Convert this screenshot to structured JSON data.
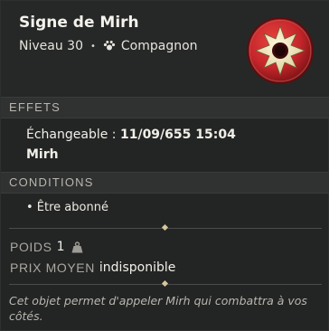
{
  "item": {
    "name": "Signe de Mirh",
    "level_label": "Niveau 30",
    "separator": "•",
    "type_label": "Compagnon",
    "icon": "mirh-sign-emblem-icon",
    "colors": {
      "emblem_red": "#c6262b",
      "emblem_star": "#ede2b8"
    }
  },
  "effects": {
    "header": "Effets",
    "exchangeable_label": "Échangeable : ",
    "exchangeable_value": "11/09/655 15:04",
    "companion_name": "Mirh"
  },
  "conditions": {
    "header": "Conditions",
    "items": [
      "• Être abonné"
    ]
  },
  "stats": {
    "weight_label": "Poids",
    "weight_value": "1",
    "weight_icon": "weight-icon",
    "price_label": "Prix moyen",
    "price_value": "indisponible"
  },
  "description": "Cet objet permet d'appeler Mirh qui combattra à vos côtés."
}
